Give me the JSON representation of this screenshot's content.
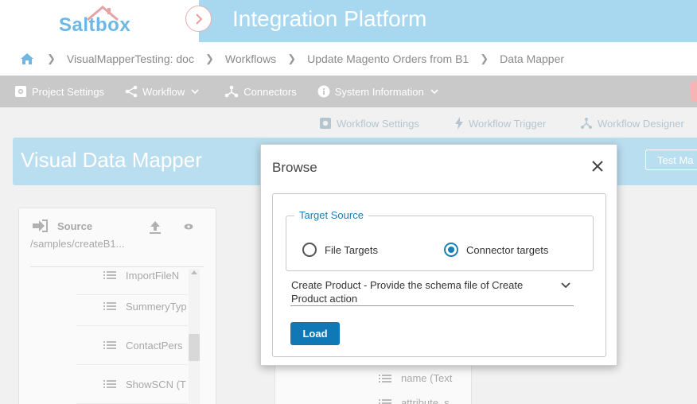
{
  "header": {
    "logo_text": "Saltbox",
    "app_title": "Integration Platform"
  },
  "breadcrumb": {
    "items": [
      "VisualMapperTesting: doc",
      "Workflows",
      "Update Magento Orders from B1",
      "Data Mapper"
    ]
  },
  "menu": {
    "project_settings": "Project Settings",
    "workflow": "Workflow",
    "connectors": "Connectors",
    "system_information": "System Information"
  },
  "subtoolbar": {
    "workflow_settings": "Workflow Settings",
    "workflow_trigger": "Workflow Trigger",
    "workflow_designer": "Workflow Designer"
  },
  "mapper": {
    "title": "Visual Data Mapper",
    "test_button": "Test Ma"
  },
  "source_panel": {
    "label": "Source",
    "path": "/samples/createB1...",
    "rows": [
      "ImportFileN",
      "SummeryTyp",
      "ContactPers",
      "ShowSCN (T"
    ]
  },
  "target_panel": {
    "rows": [
      "name (Text",
      "attribute_s"
    ]
  },
  "modal": {
    "title": "Browse",
    "fieldset_legend": "Target Source",
    "radio_file": "File Targets",
    "radio_connector": "Connector targets",
    "selected_radio": "Connector targets",
    "select_value": "Create Product - Provide the schema file of Create Product action",
    "load_button": "Load"
  },
  "colors": {
    "accent": "#1a7fb5",
    "load_button": "#0f78b5",
    "title_band": "#a8d8ef"
  }
}
